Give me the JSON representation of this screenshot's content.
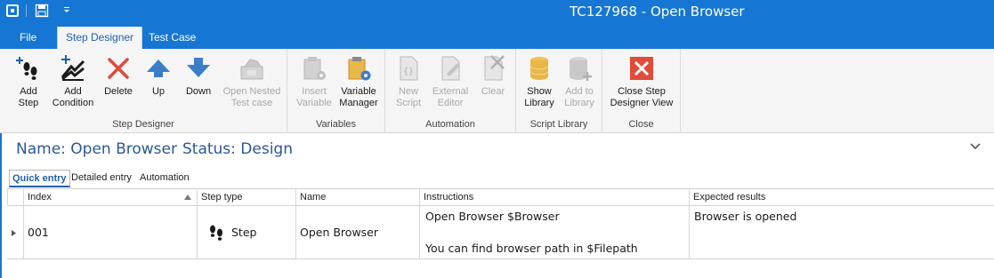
{
  "window": {
    "title": "TC127968 - Open Browser"
  },
  "tabs": [
    {
      "label": "File"
    },
    {
      "label": "Step Designer"
    },
    {
      "label": "Test Case"
    }
  ],
  "ribbon": {
    "groups": {
      "step_designer": {
        "label": "Step Designer",
        "add_step": [
          "Add",
          "Step"
        ],
        "add_condition": [
          "Add",
          "Condition"
        ],
        "delete": "Delete",
        "up": "Up",
        "down": "Down",
        "open_nested": [
          "Open Nested",
          "Test case"
        ]
      },
      "variables": {
        "label": "Variables",
        "insert_variable": [
          "Insert",
          "Variable"
        ],
        "variable_manager": [
          "Variable",
          "Manager"
        ]
      },
      "automation": {
        "label": "Automation",
        "new_script": [
          "New",
          "Script"
        ],
        "external_editor": [
          "External",
          "Editor"
        ],
        "clear": "Clear"
      },
      "script_library": {
        "label": "Script Library",
        "show_library": [
          "Show",
          "Library"
        ],
        "add_to_library": [
          "Add to",
          "Library"
        ]
      },
      "close": {
        "label": "Close",
        "close_view": [
          "Close Step",
          "Designer View"
        ]
      }
    }
  },
  "header": {
    "name": "Name: Open Browser",
    "status": "Status: Design"
  },
  "subtabs": [
    {
      "label": "Quick entry"
    },
    {
      "label": "Detailed entry"
    },
    {
      "label": "Automation"
    }
  ],
  "grid": {
    "columns": [
      "Index",
      "Step type",
      "Name",
      "Instructions",
      "Expected results"
    ],
    "rows": [
      {
        "index": "001",
        "step_type": "Step",
        "name": "Open Browser",
        "instructions_line1": "Open Browser $Browser",
        "instructions_line2": "You can find browser path in $Filepath",
        "expected": "Browser is opened"
      }
    ]
  },
  "colors": {
    "accent": "#1676d3",
    "title_text": "#2b5797",
    "close_red": "#e04b3a"
  },
  "icons": [
    "app-icon",
    "save-icon",
    "quick-access-icon",
    "footsteps-icon",
    "add-condition-icon",
    "delete-icon",
    "arrow-up-icon",
    "arrow-down-icon",
    "open-nested-icon",
    "insert-variable-icon",
    "variable-manager-icon",
    "new-script-icon",
    "external-editor-icon",
    "clear-icon",
    "show-library-icon",
    "add-to-library-icon",
    "close-view-icon",
    "collapse-chevron-icon",
    "sort-asc-icon",
    "row-arrow-icon"
  ]
}
